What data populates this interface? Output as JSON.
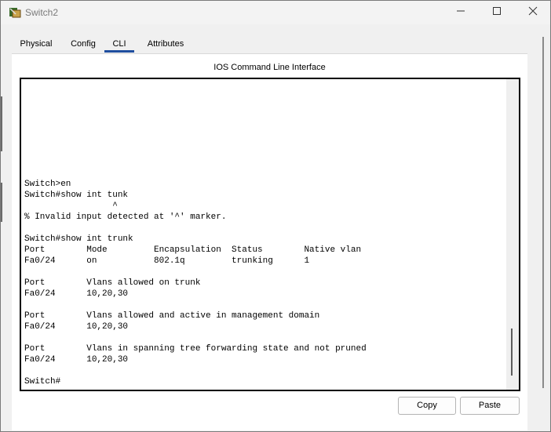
{
  "window": {
    "title": "Switch2",
    "controls": {
      "minimize_icon": "minimize-icon",
      "maximize_icon": "maximize-icon",
      "close_icon": "close-icon"
    }
  },
  "tabs": [
    {
      "label": "Physical"
    },
    {
      "label": "Config"
    },
    {
      "label": "CLI"
    },
    {
      "label": "Attributes"
    }
  ],
  "active_tab": "CLI",
  "panel": {
    "header": "IOS Command Line Interface"
  },
  "terminal": {
    "text": "Switch>en\nSwitch#show int tunk\n                 ^\n% Invalid input detected at '^' marker.\n\nSwitch#show int trunk\nPort        Mode         Encapsulation  Status        Native vlan\nFa0/24      on           802.1q         trunking      1\n\nPort        Vlans allowed on trunk\nFa0/24      10,20,30\n\nPort        Vlans allowed and active in management domain\nFa0/24      10,20,30\n\nPort        Vlans in spanning tree forwarding state and not pruned\nFa0/24      10,20,30\n\nSwitch#"
  },
  "buttons": {
    "copy": "Copy",
    "paste": "Paste"
  },
  "colors": {
    "tab_accent": "#1f4e9e",
    "terminal_border": "#000000",
    "title_text": "#7a7a7a"
  }
}
